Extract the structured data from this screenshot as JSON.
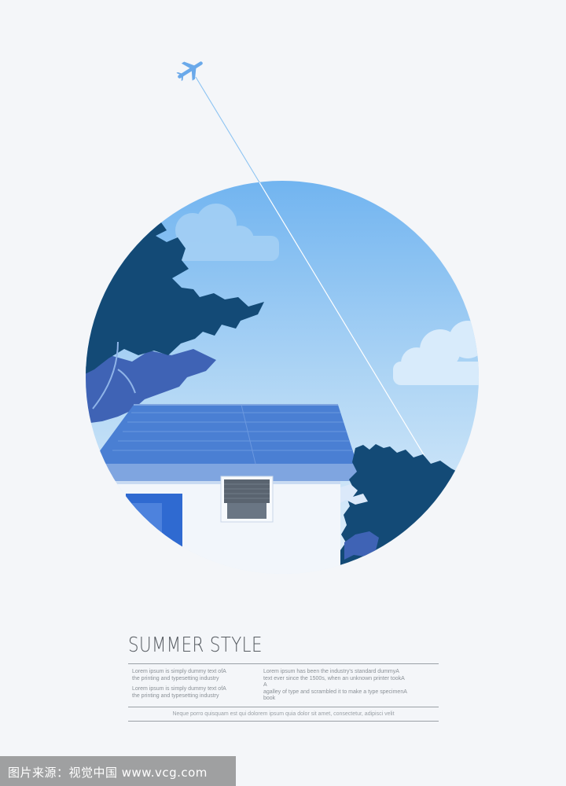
{
  "poster": {
    "title": "SUMMER STYLE",
    "left_column": [
      "Lorem ipsum is simply dummy text ofA",
      "the printing and typesetting industry",
      "Lorem ipsum is simply dummy text ofA",
      "the printing and typesetting industry"
    ],
    "right_column": [
      "Lorem ipsum has been the industry's standard dummyA",
      "text ever since the 1500s, when an unknown printer tookA",
      "A",
      "agalley of type and scrambled it to make a type specimenA",
      "book"
    ],
    "footer": "Neque porro quisquam est qui dolorem ipsum quia dolor sit amet, consectetur, adipisci velit"
  },
  "watermark": {
    "text": "图片来源：视觉中国 www.vcg.com"
  },
  "colors": {
    "background": "#f4f6f9",
    "sky_top": "#6fb3f0",
    "sky_bottom": "#e6f2fc",
    "foliage": "#134a76",
    "foliage_light": "#3f63b5",
    "roof": "#4a7fd3",
    "wall": "#f2f6fb",
    "eave": "#7fa5e0",
    "title_text": "#555a60"
  }
}
